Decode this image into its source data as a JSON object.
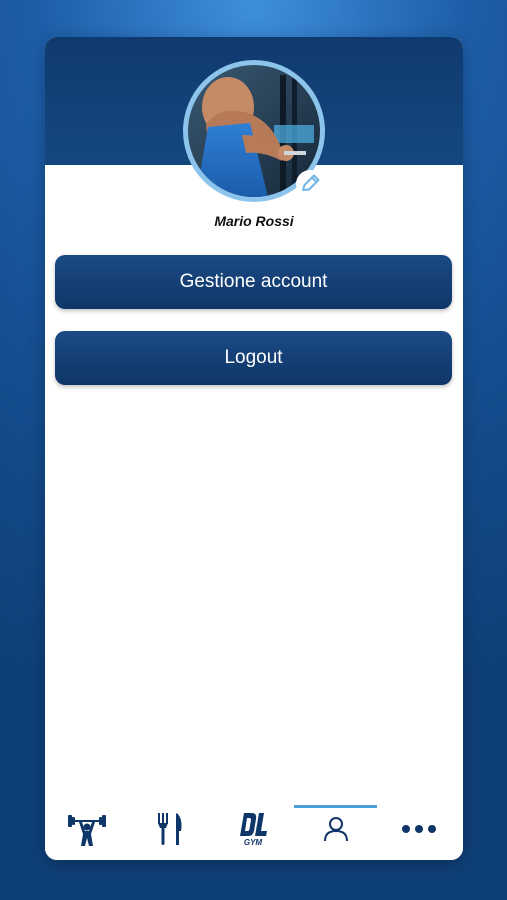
{
  "profile": {
    "name": "Mario Rossi",
    "avatar_icon": "user-photo",
    "edit_icon": "pencil-icon"
  },
  "actions": {
    "account_label": "Gestione account",
    "logout_label": "Logout"
  },
  "nav": {
    "items": [
      {
        "icon": "weightlifting-icon"
      },
      {
        "icon": "fork-knife-icon"
      },
      {
        "icon": "gym-logo-icon",
        "logo_text": "GYM"
      },
      {
        "icon": "user-icon",
        "active": true
      },
      {
        "icon": "more-icon"
      }
    ]
  },
  "colors": {
    "primary": "#0f3668",
    "accent": "#4aa1dc",
    "background": "#1d5ea8"
  }
}
